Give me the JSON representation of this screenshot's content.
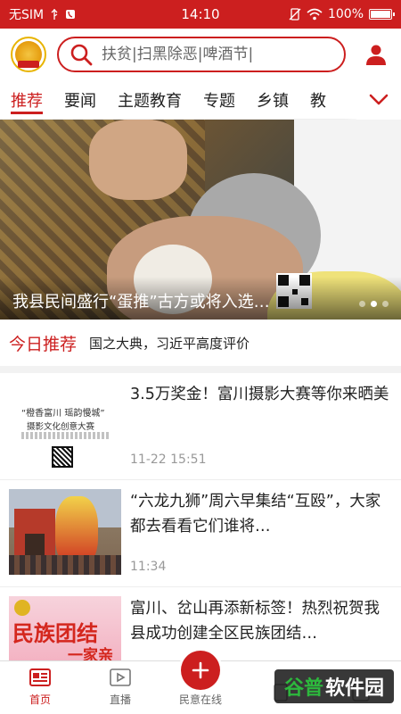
{
  "status_bar": {
    "carrier": "无SIM",
    "time": "14:10",
    "battery": "100%"
  },
  "header": {
    "search_placeholder": "扶贫|扫黑除恶|啤酒节|"
  },
  "tabs": [
    {
      "label": "推荐",
      "active": true
    },
    {
      "label": "要闻",
      "active": false
    },
    {
      "label": "主题教育",
      "active": false
    },
    {
      "label": "专题",
      "active": false
    },
    {
      "label": "乡镇",
      "active": false
    },
    {
      "label": "教",
      "active": false
    }
  ],
  "banner": {
    "caption": "我县民间盛行“蛋推”古方或将入选…",
    "slide_index": 2,
    "slide_count": 3
  },
  "today": {
    "label": "今日推荐",
    "text": "国之大典，习近平高度评价"
  },
  "news": [
    {
      "title": "3.5万奖金！富川摄影大赛等你来晒美",
      "time": "11-22 15:51",
      "thumb_text_1": "“橙香富川 瑶韵慢城”",
      "thumb_text_2": "摄影文化创意大赛"
    },
    {
      "title": "“六龙九狮”周六早集结“互殴”，大家都去看看它们谁将…",
      "time": "11:34"
    },
    {
      "title": "富川、岔山再添新标签！热烈祝贺我县成功创建全区民族团结…",
      "time": "",
      "thumb_text_1": "民族团结",
      "thumb_text_2": "一家亲"
    }
  ],
  "bottom_nav": [
    {
      "label": "首页",
      "active": true
    },
    {
      "label": "直播",
      "active": false
    },
    {
      "label": "民意在线",
      "active": false
    },
    {
      "label": "",
      "active": false
    },
    {
      "label": "",
      "active": false
    }
  ],
  "watermark": {
    "part1": "谷普",
    "part2": "软件园"
  },
  "colors": {
    "accent": "#cc1f1f"
  }
}
